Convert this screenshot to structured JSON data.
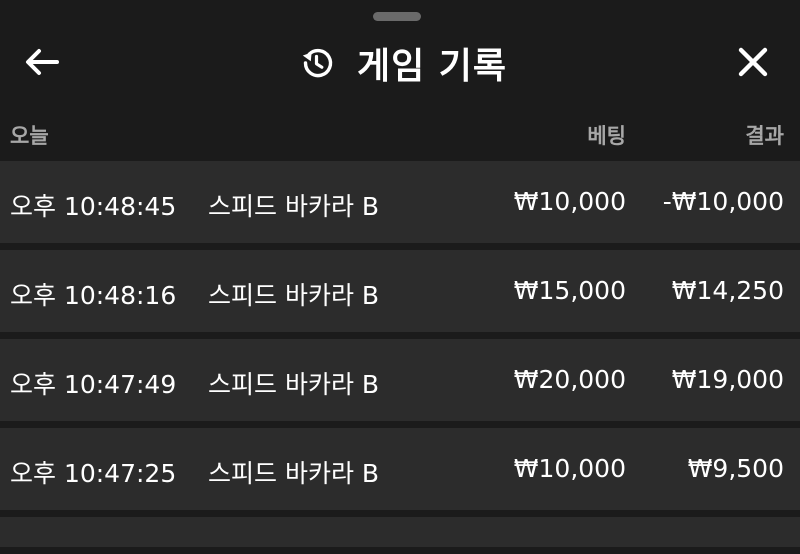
{
  "header": {
    "title": "게임 기록",
    "back_icon": "arrow-left-icon",
    "history_icon": "history-icon",
    "close_icon": "close-icon"
  },
  "columns": {
    "date": "오늘",
    "bet": "베팅",
    "result": "결과"
  },
  "rows": [
    {
      "time": "오후 10:48:45",
      "game": "스피드 바카라 B",
      "bet": "₩10,000",
      "result": "-₩10,000"
    },
    {
      "time": "오후 10:48:16",
      "game": "스피드 바카라 B",
      "bet": "₩15,000",
      "result": "₩14,250"
    },
    {
      "time": "오후 10:47:49",
      "game": "스피드 바카라 B",
      "bet": "₩20,000",
      "result": "₩19,000"
    },
    {
      "time": "오후 10:47:25",
      "game": "스피드 바카라 B",
      "bet": "₩10,000",
      "result": "₩9,500"
    }
  ],
  "colors": {
    "background": "#1b1b1b",
    "row_background": "#2c2c2c",
    "text_primary": "#ffffff",
    "text_secondary": "#a7a7a7"
  }
}
